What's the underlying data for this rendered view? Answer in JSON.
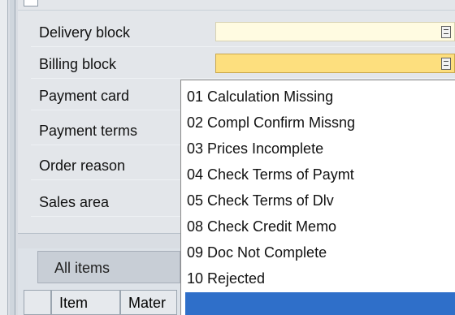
{
  "fields": [
    {
      "label": "Delivery block",
      "value": ""
    },
    {
      "label": "Billing block",
      "value": ""
    },
    {
      "label": "Payment card",
      "value": ""
    },
    {
      "label": "Payment terms",
      "value": ""
    },
    {
      "label": "Order reason",
      "value": ""
    },
    {
      "label": "Sales area",
      "value": ""
    }
  ],
  "tabs": {
    "active": "All items"
  },
  "grid": {
    "columns": [
      "Item",
      "Mater"
    ]
  },
  "dropdown": {
    "options": [
      "01 Calculation Missing",
      "02 Compl Confirm Missng",
      "03 Prices Incomplete",
      "04 Check Terms of Paymt",
      "05 Check Terms of Dlv",
      "08 Check Credit Memo",
      "09 Doc Not Complete",
      "10 Rejected",
      ""
    ],
    "highlight_index": 8,
    "highlight_color": "#2f6fc9"
  },
  "colors": {
    "field_bg": "#fffbe1",
    "focused_field_bg": "#fddf7e"
  }
}
